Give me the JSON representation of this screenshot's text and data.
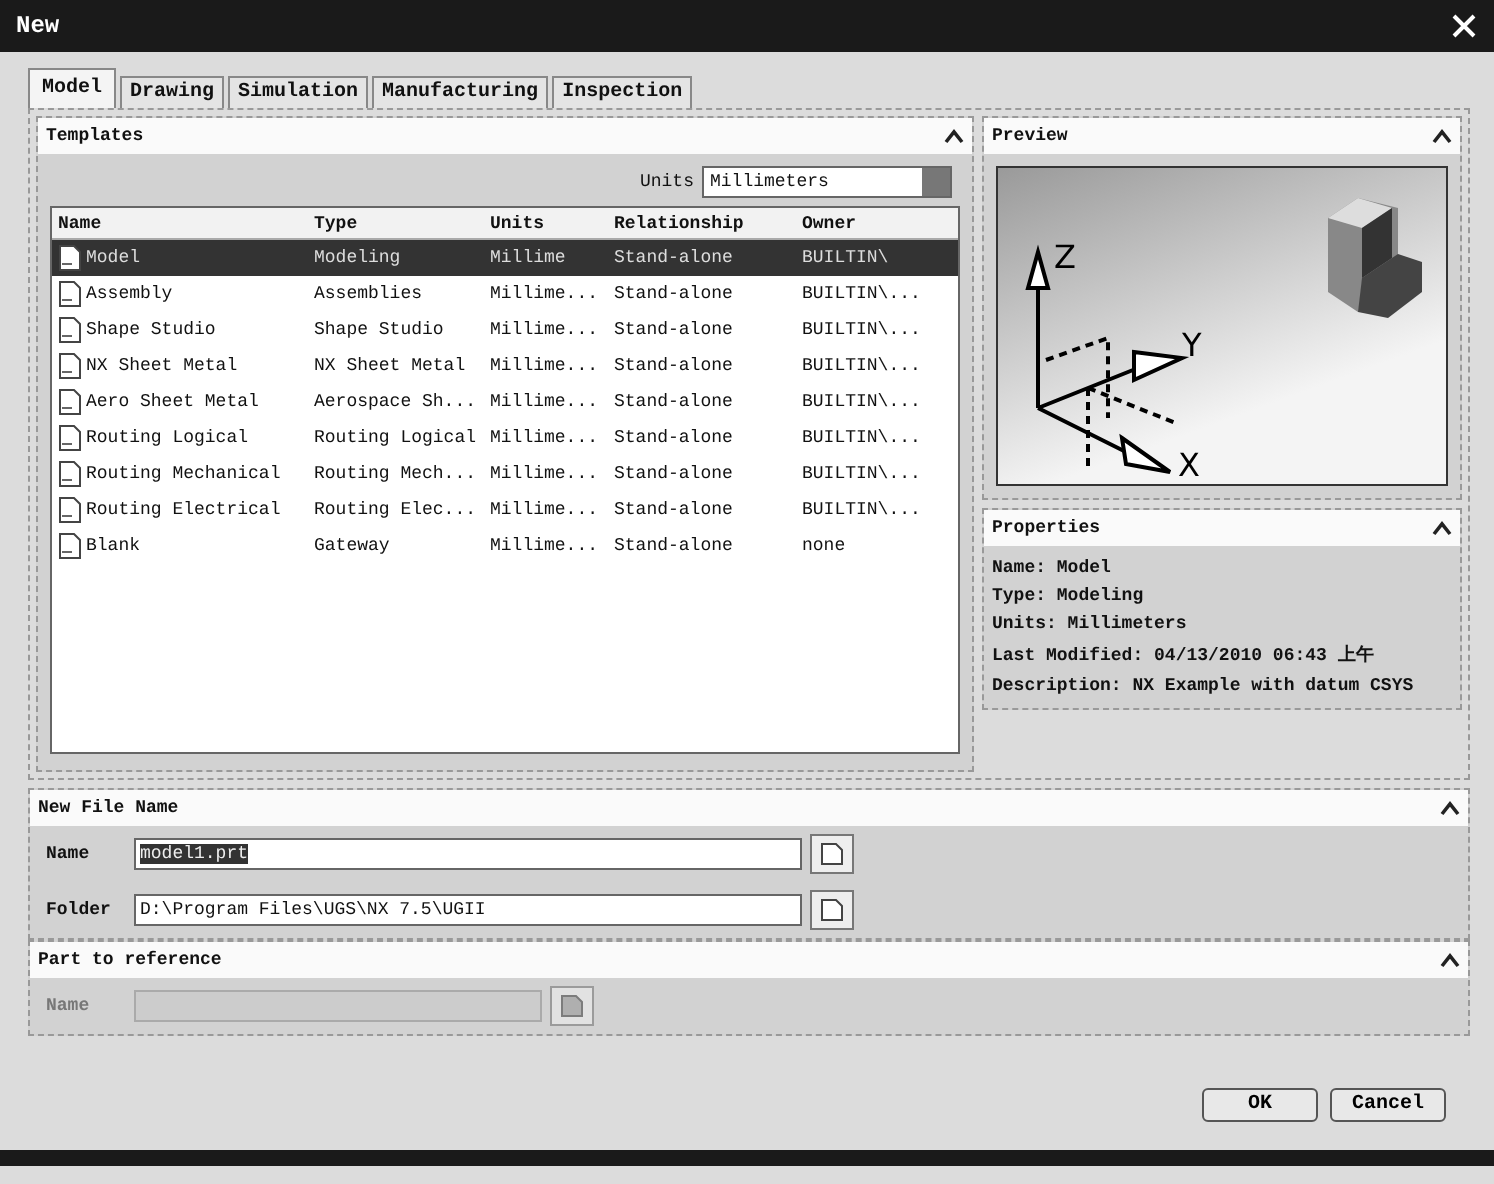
{
  "window": {
    "title": "New"
  },
  "tabs": [
    {
      "label": "Model",
      "selected": true
    },
    {
      "label": "Drawing",
      "selected": false
    },
    {
      "label": "Simulation",
      "selected": false
    },
    {
      "label": "Manufacturing",
      "selected": false
    },
    {
      "label": "Inspection",
      "selected": false
    }
  ],
  "templates": {
    "title": "Templates",
    "units_label": "Units",
    "units_value": "Millimeters",
    "columns": [
      "Name",
      "Type",
      "Units",
      "Relationship",
      "Owner"
    ],
    "rows": [
      {
        "cells": [
          "Model",
          "Modeling",
          "Millime",
          "Stand-alone",
          "BUILTIN\\"
        ],
        "selected": true
      },
      {
        "cells": [
          "Assembly",
          "Assemblies",
          "Millime...",
          "Stand-alone",
          "BUILTIN\\..."
        ],
        "selected": false
      },
      {
        "cells": [
          "Shape Studio",
          "Shape Studio",
          "Millime...",
          "Stand-alone",
          "BUILTIN\\..."
        ],
        "selected": false
      },
      {
        "cells": [
          "NX Sheet Metal",
          "NX Sheet Metal",
          "Millime...",
          "Stand-alone",
          "BUILTIN\\..."
        ],
        "selected": false
      },
      {
        "cells": [
          "Aero Sheet Metal",
          "Aerospace Sh...",
          "Millime...",
          "Stand-alone",
          "BUILTIN\\..."
        ],
        "selected": false
      },
      {
        "cells": [
          "Routing Logical",
          "Routing Logical",
          "Millime...",
          "Stand-alone",
          "BUILTIN\\..."
        ],
        "selected": false
      },
      {
        "cells": [
          "Routing Mechanical",
          "Routing Mech...",
          "Millime...",
          "Stand-alone",
          "BUILTIN\\..."
        ],
        "selected": false
      },
      {
        "cells": [
          "Routing Electrical",
          "Routing Elec...",
          "Millime...",
          "Stand-alone",
          "BUILTIN\\..."
        ],
        "selected": false
      },
      {
        "cells": [
          "Blank",
          "Gateway",
          "Millime...",
          "Stand-alone",
          "none"
        ],
        "selected": false
      }
    ]
  },
  "preview": {
    "title": "Preview",
    "axis_labels": [
      "Z",
      "Y",
      "X"
    ]
  },
  "properties": {
    "title": "Properties",
    "lines": [
      "Name: Model",
      "Type: Modeling",
      "Units: Millimeters",
      "Last Modified: 04/13/2010 06:43 上午",
      "Description: NX Example with datum CSYS"
    ]
  },
  "new_file_name": {
    "title": "New File Name",
    "name_label": "Name",
    "name_value": "model1.prt",
    "name_value_selected": true,
    "folder_label": "Folder",
    "folder_value": "D:\\Program Files\\UGS\\NX 7.5\\UGII"
  },
  "part_to_reference": {
    "title": "Part to reference",
    "name_label": "Name",
    "disabled": true
  },
  "buttons": [
    "OK",
    "Cancel"
  ]
}
